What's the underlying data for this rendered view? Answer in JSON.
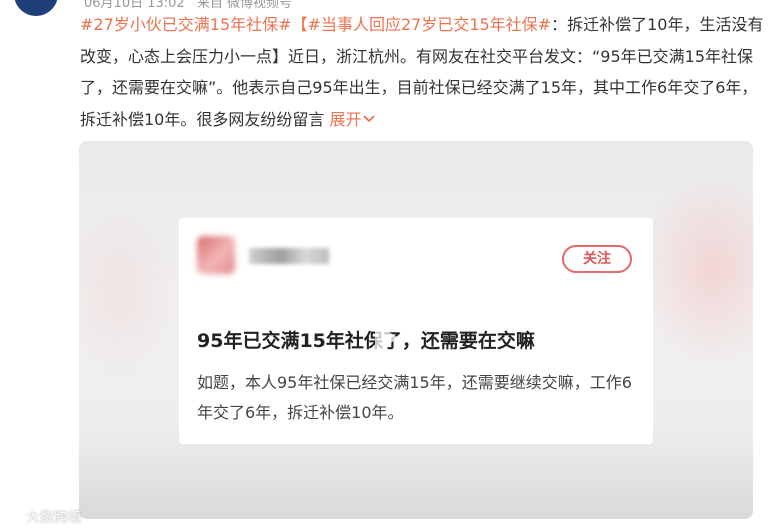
{
  "post": {
    "meta_date": "06月10日 13:02",
    "meta_source": "来自 微博视频号",
    "hashtag_1": "#27岁小伙已交满15年社保#",
    "hashtag_2": "【#当事人回应27岁已交15年社保#",
    "text": "：拆迁补偿了10年，生活没有改变，心态上会压力小一点】近日，浙江杭州。有网友在社交平台发文：“95年已交满15年社保了，还需要在交嘛”。他表示自己95年出生，目前社保已经交满了15年，其中工作6年交了6年，拆迁补偿10年。很多网友纷纷留言",
    "expand_label": "展开",
    "expand_icon": "chevron-down-icon"
  },
  "video": {
    "follow_label": "关注",
    "card_title": "95年已交满15年社保了，还需要在交嘛",
    "card_body": "如题，本人95年社保已经交满15年，还需要继续交嘛，工作6年交了6年，拆迁补偿10年。"
  },
  "watermark": {
    "text": "大数跨境"
  },
  "colors": {
    "accent": "#eb7350",
    "follow_border": "#e26a6a"
  }
}
